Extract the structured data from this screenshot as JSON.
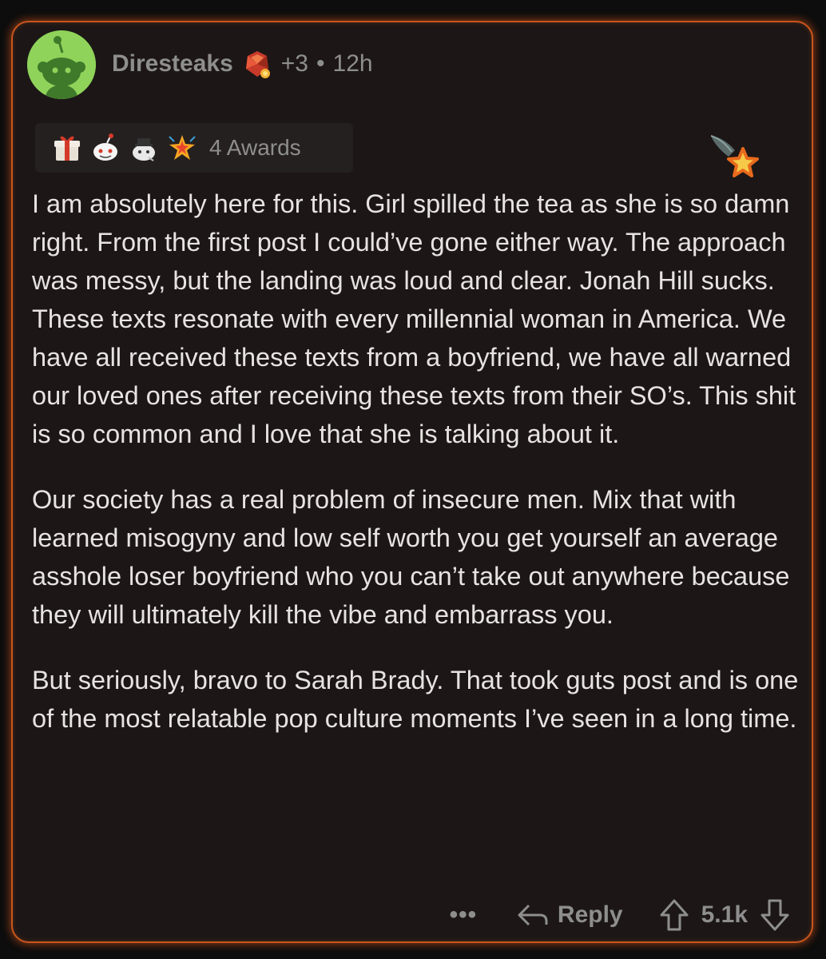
{
  "comment": {
    "author": "Diresteaks",
    "score_badge": "+3",
    "separator": "•",
    "age": "12h",
    "awards_label": "4 Awards",
    "award_icons": [
      "gift-award-icon",
      "snoo-award-icon",
      "wholesome-award-icon",
      "starstruck-award-icon"
    ],
    "paragraphs": [
      "I am absolutely here for this. Girl spilled the tea as she is so damn right. From the first post I could’ve gone either way. The approach was messy, but the landing was loud and clear. Jonah Hill sucks. These texts resonate with every millennial woman in America. We have all received these texts from a boyfriend, we have all warned our loved ones after receiving these texts from their SO’s. This shit is so common and I love that she is talking about it.",
      "Our society has a real problem of insecure men. Mix that with learned misogyny and low self worth you get yourself an average asshole loser boyfriend who you can’t take out anywhere because they will ultimately kill the vibe and embarrass you.",
      "But seriously, bravo to Sarah Brady. That took guts post and is one of the most relatable pop culture moments I’ve seen in a long time."
    ],
    "more_label": "•••",
    "reply_label": "Reply",
    "vote_count": "5.1k"
  },
  "colors": {
    "card_border": "#c8551c",
    "card_bg": "#1c1716",
    "avatar_bg": "#8fd35a",
    "muted_text": "#8e8e8e",
    "body_text": "#e7e3e1"
  }
}
